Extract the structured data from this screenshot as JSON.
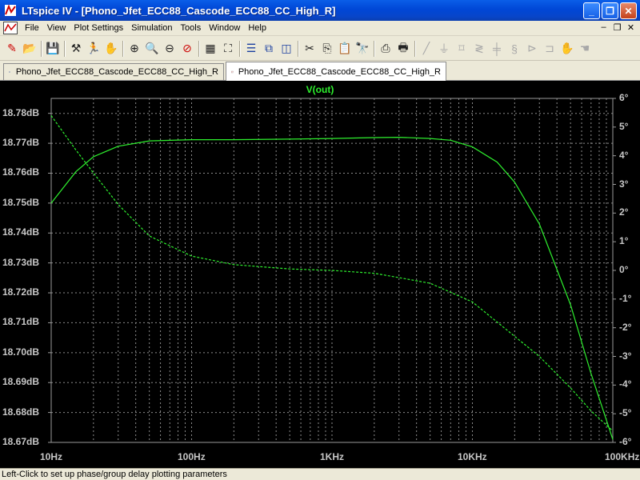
{
  "window": {
    "title": "LTspice IV - [Phono_Jfet_ECC88_Cascode_ECC88_CC_High_R]"
  },
  "menu": [
    "File",
    "View",
    "Plot Settings",
    "Simulation",
    "Tools",
    "Window",
    "Help"
  ],
  "toolbar": {
    "icons": [
      "new-schematic-icon",
      "open-icon",
      "save-icon",
      "control-panel-icon",
      "run-icon",
      "halt-icon",
      "zoom-in-icon",
      "zoom-area-icon",
      "zoom-out-icon",
      "zoom-cancel-icon",
      "autorange-icon",
      "zoom-extents-icon",
      "tile-horizontal-icon",
      "cascade-icon",
      "tile-vertical-icon",
      "cut-icon",
      "copy-icon",
      "paste-icon",
      "find-icon",
      "print-preview-icon",
      "print-icon",
      "draw-wire-icon",
      "ground-icon",
      "label-net-icon",
      "resistor-icon",
      "capacitor-icon",
      "inductor-icon",
      "diode-icon",
      "component-icon",
      "move-icon",
      "drag-icon"
    ]
  },
  "tabs": [
    {
      "label": "Phono_Jfet_ECC88_Cascode_ECC88_CC_High_R",
      "active": false
    },
    {
      "label": "Phono_Jfet_ECC88_Cascode_ECC88_CC_High_R",
      "active": true
    }
  ],
  "status": "Left-Click to set up phase/group delay plotting parameters",
  "colors": {
    "trace": "#2ef02e",
    "grid": "#8c8c8c",
    "background": "#000000",
    "axis_text": "#c8c8c8"
  },
  "chart_data": {
    "type": "line",
    "title": "V(out)",
    "x_scale": "log",
    "xlim": [
      10,
      100000
    ],
    "x_tick_labels": [
      "10Hz",
      "100Hz",
      "1KHz",
      "10KHz",
      "100KHz"
    ],
    "ylim": [
      18.67,
      18.785
    ],
    "y_tick_labels": [
      "18.78dB",
      "18.77dB",
      "18.76dB",
      "18.75dB",
      "18.74dB",
      "18.73dB",
      "18.72dB",
      "18.71dB",
      "18.70dB",
      "18.69dB",
      "18.68dB",
      "18.67dB"
    ],
    "y2lim": [
      -6,
      6
    ],
    "y2_tick_labels": [
      "6°",
      "5°",
      "4°",
      "3°",
      "2°",
      "1°",
      "0°",
      "-1°",
      "-2°",
      "-3°",
      "-4°",
      "-5°",
      "-6°"
    ],
    "series": [
      {
        "style": "solid",
        "axis": "left",
        "x": [
          10,
          15,
          20,
          30,
          50,
          100,
          200,
          500,
          1000,
          2000,
          3000,
          5000,
          7000,
          10000,
          15000,
          20000,
          30000,
          50000,
          70000,
          100000
        ],
        "y": [
          18.75,
          18.7605,
          18.7655,
          18.769,
          18.7708,
          18.7712,
          18.7712,
          18.7714,
          18.7716,
          18.7719,
          18.772,
          18.7716,
          18.771,
          18.7688,
          18.7637,
          18.757,
          18.743,
          18.716,
          18.693,
          18.671
        ]
      },
      {
        "style": "dashed",
        "axis": "right",
        "x": [
          10,
          15,
          20,
          30,
          50,
          100,
          200,
          500,
          1000,
          2000,
          3000,
          5000,
          10000,
          20000,
          30000,
          50000,
          70000,
          100000
        ],
        "y": [
          5.4,
          4.2,
          3.4,
          2.3,
          1.2,
          0.5,
          0.2,
          0.05,
          0.0,
          -0.1,
          -0.25,
          -0.45,
          -1.1,
          -2.3,
          -3.0,
          -4.1,
          -4.9,
          -5.6
        ]
      }
    ]
  }
}
